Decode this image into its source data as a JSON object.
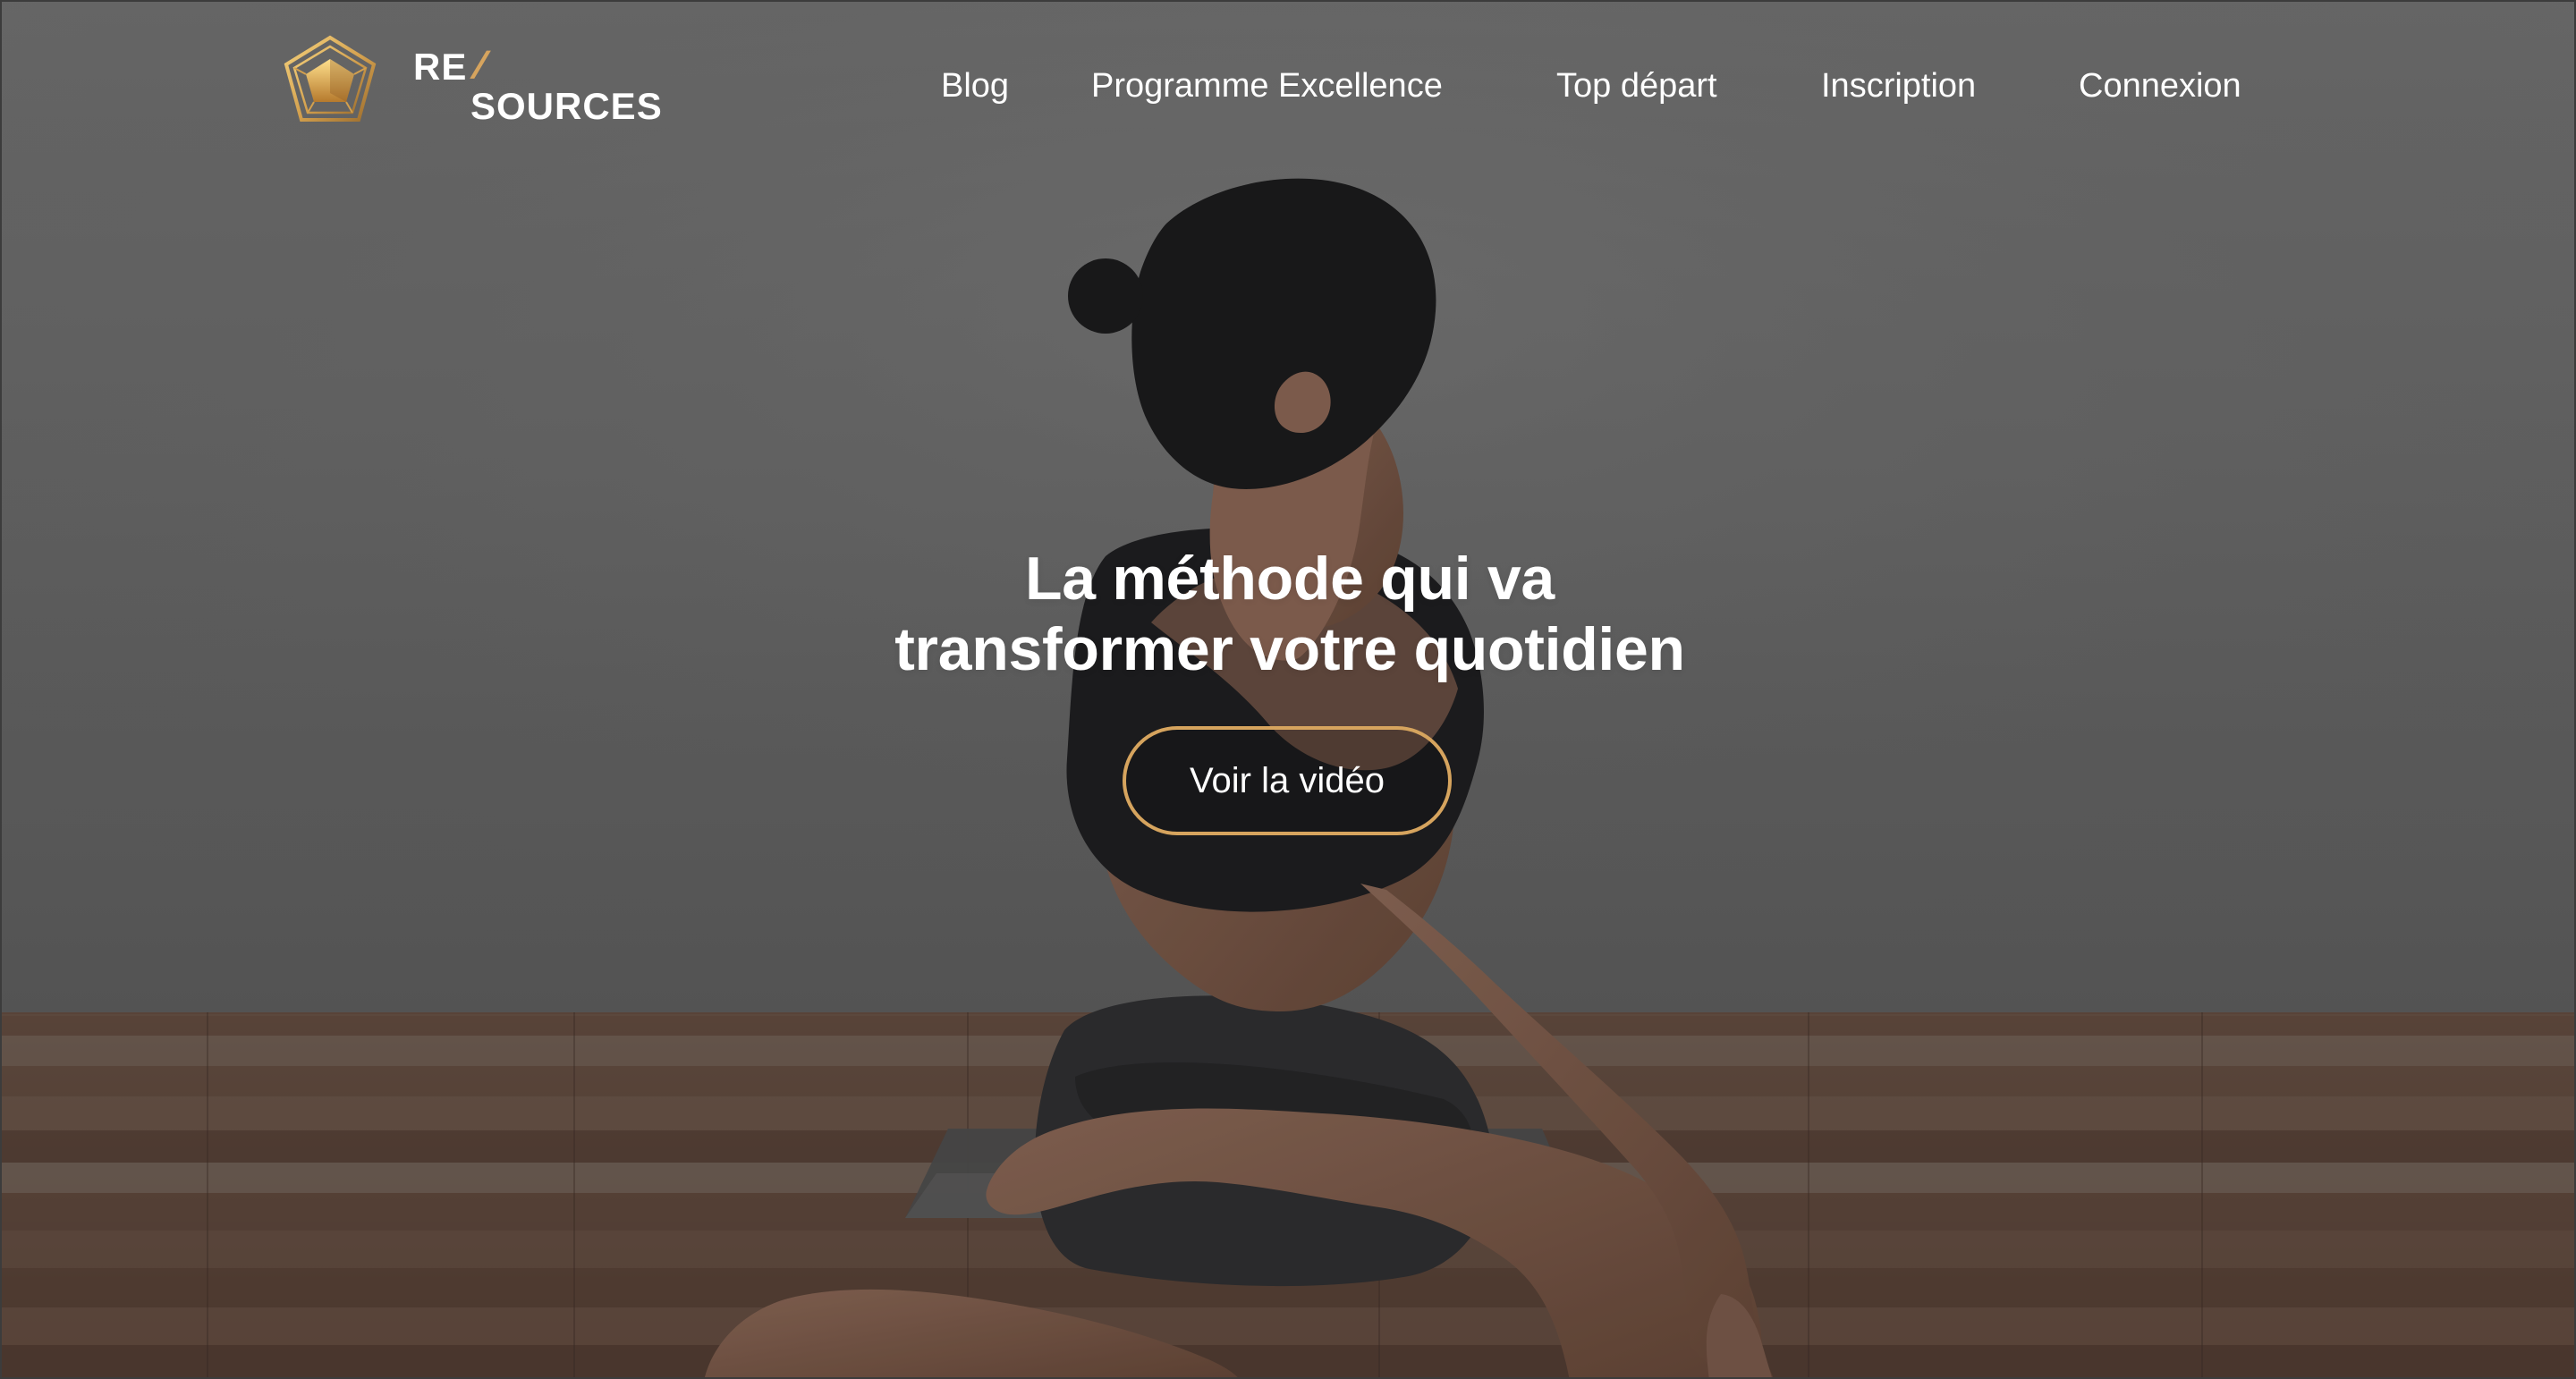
{
  "branding": {
    "logo_top": "RE",
    "logo_slash": "/",
    "logo_bottom": "SOURCES",
    "accent_color": "#d6a45e"
  },
  "nav": {
    "items": [
      {
        "label": "Blog"
      },
      {
        "label": "Programme Excellence"
      },
      {
        "label": "Top départ"
      },
      {
        "label": "Inscription"
      },
      {
        "label": "Connexion"
      }
    ]
  },
  "hero": {
    "headline_line1": "La méthode qui va",
    "headline_line2": "transformer votre quotidien",
    "cta_label": "Voir la vidéo",
    "icon": "pentagon-badge-icon",
    "background_image": "yoga-woman-photo"
  }
}
